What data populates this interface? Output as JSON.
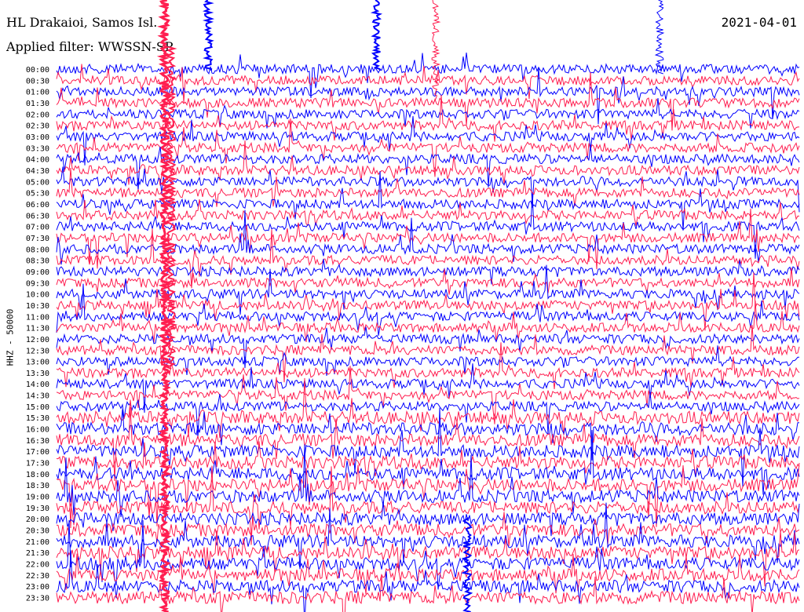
{
  "header": {
    "title": "HL Drakaioi, Samos Isl.",
    "date": "2021-04-01",
    "filter": "Applied filter: WWSSN-SP"
  },
  "chart_data": {
    "type": "line",
    "title": "HL Drakaioi, Samos Isl.",
    "date": "2021-04-01",
    "filter": "WWSSN-SP",
    "ylabel": "HHZ - 50000",
    "row_labels": [
      "00:00",
      "00:30",
      "01:00",
      "01:30",
      "02:00",
      "02:30",
      "03:00",
      "03:30",
      "04:00",
      "04:30",
      "05:00",
      "05:30",
      "06:00",
      "06:30",
      "07:00",
      "07:30",
      "08:00",
      "08:30",
      "09:00",
      "09:30",
      "10:00",
      "10:30",
      "11:00",
      "11:30",
      "12:00",
      "12:30",
      "13:00",
      "13:30",
      "14:00",
      "14:30",
      "15:00",
      "15:30",
      "16:00",
      "16:30",
      "17:00",
      "17:30",
      "18:00",
      "18:30",
      "19:00",
      "19:30",
      "20:00",
      "20:30",
      "21:00",
      "21:30",
      "22:00",
      "22:30",
      "23:00",
      "23:30"
    ],
    "series_colors": [
      "#0000ff",
      "#ff1e50"
    ],
    "grid": false,
    "legend": "none"
  },
  "colors": {
    "trace_a": "#0000ff",
    "trace_b": "#ff1e50",
    "background": "#ffffff",
    "text": "#000000"
  }
}
